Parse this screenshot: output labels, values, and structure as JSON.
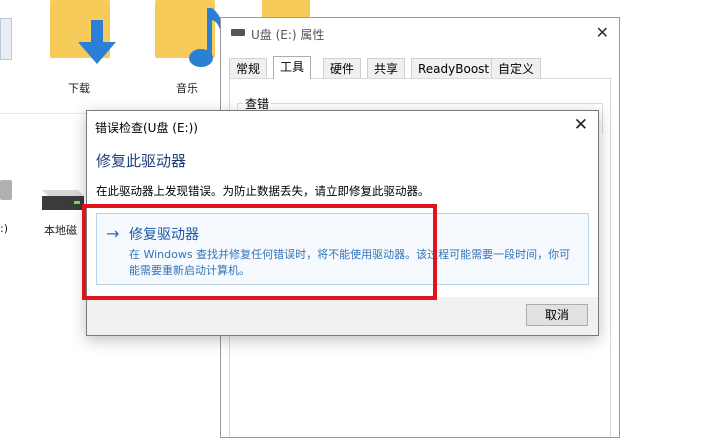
{
  "explorer": {
    "items": [
      {
        "label": "下载"
      },
      {
        "label": "音乐"
      },
      {
        "label": "本地磁"
      },
      {
        "label": ":)"
      }
    ]
  },
  "properties": {
    "title": "U盘 (E:) 属性",
    "tabs": [
      {
        "label": "常规"
      },
      {
        "label": "工具"
      },
      {
        "label": "硬件"
      },
      {
        "label": "共享"
      },
      {
        "label": "ReadyBoost"
      },
      {
        "label": "自定义"
      }
    ],
    "active_tab": "工具",
    "group_label": "查错"
  },
  "dialog": {
    "title": "错误检查(U盘 (E:))",
    "heading": "修复此驱动器",
    "message": "在此驱动器上发现错误。为防止数据丢失，请立即修复此驱动器。",
    "command_link": {
      "title": "修复驱动器",
      "description": "在 Windows 查找并修复任何错误时，将不能使用驱动器。该过程可能需要一段时间，你可能需要重新启动计算机。"
    },
    "cancel_label": "取消"
  },
  "colors": {
    "highlight": "#e0151b",
    "link_blue": "#1f56a4",
    "heading_blue": "#1f3f7a"
  }
}
